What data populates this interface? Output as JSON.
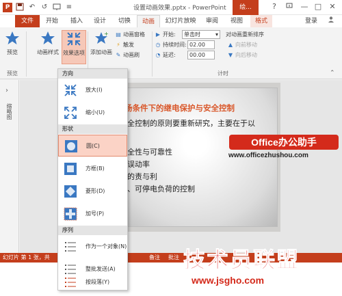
{
  "titlebar": {
    "doc_title": "设置动画效果.pptx - PowerPoint",
    "context_tab": "绘...",
    "help": "?",
    "minimize": "—",
    "restore": "□",
    "close": "✕",
    "quick_icons": [
      "P",
      "💾",
      "↶",
      "↺",
      "🖫",
      "≡"
    ]
  },
  "tabs": {
    "file": "文件",
    "items": [
      "开始",
      "插入",
      "设计",
      "切换",
      "动画",
      "幻灯片放映",
      "审阅",
      "视图",
      "格式"
    ],
    "active": "动画",
    "login": "登录"
  },
  "ribbon": {
    "preview": "预览",
    "preview_group": "预览",
    "animation_style": "动画样式",
    "effect_options": "效果选项",
    "add_animation": "添加动画",
    "animation_pane": "动画窗格",
    "trigger": "触发",
    "painter": "动画刷",
    "animation_group": "动画",
    "start_label": "开始:",
    "start_value": "单击时",
    "duration_label": "持续时间:",
    "duration_value": "02.00",
    "delay_label": "延迟:",
    "delay_value": "00.00",
    "reorder_title": "对动画重新排序",
    "move_earlier": "向前移动",
    "move_later": "向后移动",
    "timing_group": "计时"
  },
  "left_panel": {
    "chevron": "›",
    "label": "缩略图"
  },
  "slide": {
    "title": "场条件下的继电保护与安全控制",
    "lines": [
      "全控制的原则要重新研究，主要在于以",
      "全性与可靠性",
      "误动率",
      "的责与利",
      "、可停电负荷的控制"
    ]
  },
  "watermark": {
    "badge": "Office办公助手",
    "url": "www.officezhushou.com",
    "logo": "技术员联盟",
    "logo_url": "www.jsgho.com"
  },
  "statusbar": {
    "left": "幻灯片 第 1 张，共",
    "notes": "备注",
    "comments": "批注"
  },
  "dropdown": {
    "section_direction": "方向",
    "section_shape": "形状",
    "section_sequence": "序列",
    "items": [
      {
        "label": "放大(I)",
        "icon": "zoom-in-icon"
      },
      {
        "label": "缩小(U)",
        "icon": "zoom-out-icon"
      },
      {
        "label": "圆(C)",
        "icon": "circle-shape-icon"
      },
      {
        "label": "方框(B)",
        "icon": "box-shape-icon"
      },
      {
        "label": "菱形(D)",
        "icon": "diamond-shape-icon"
      },
      {
        "label": "加号(P)",
        "icon": "plus-shape-icon"
      },
      {
        "label": "作为一个对象(N)",
        "icon": "as-one-object-icon"
      },
      {
        "label": "整批发送(A)",
        "icon": "all-at-once-icon"
      },
      {
        "label": "按段落(Y)",
        "icon": "by-paragraph-icon"
      }
    ],
    "selected": "圆(C)"
  },
  "colors": {
    "accent": "#c43e1c",
    "selected_bg": "#fbd3c6",
    "watermark_red": "#d42a1b"
  }
}
